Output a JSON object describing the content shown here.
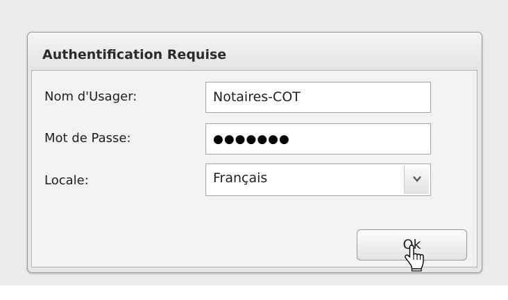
{
  "dialog": {
    "title": "Authentification Requise",
    "fields": {
      "username": {
        "label": "Nom d'Usager:",
        "value": "Notaires-COT"
      },
      "password": {
        "label": "Mot de Passe:",
        "masked_value": "●●●●●●●"
      },
      "locale": {
        "label": "Locale:",
        "selected": "Français"
      }
    },
    "ok_label": "Ok"
  },
  "icons": {
    "dropdown": "chevron-down-icon",
    "cursor": "hand-pointer-icon"
  },
  "colors": {
    "background": "#ececec",
    "dialog_body": "#f2f2f2",
    "input_border": "#a6a6a6"
  }
}
